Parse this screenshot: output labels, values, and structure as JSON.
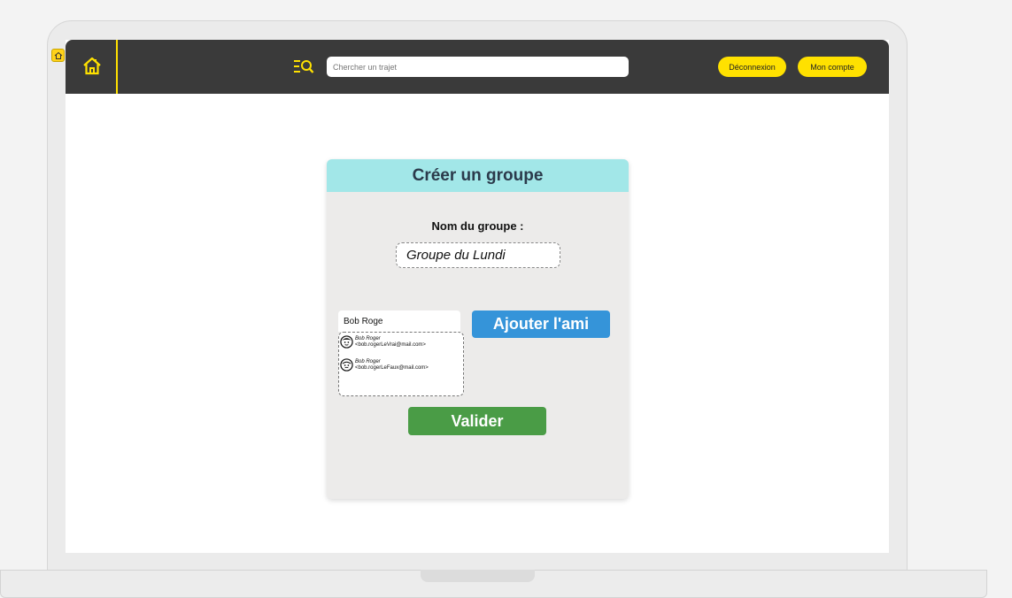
{
  "navbar": {
    "search_placeholder": "Chercher un trajet",
    "logout_label": "Déconnexion",
    "account_label": "Mon compte",
    "accent_color": "#ffe100",
    "bar_color": "#3a3a3a"
  },
  "card": {
    "title": "Créer un groupe",
    "group_name_label": "Nom du groupe :",
    "group_name_value": "Groupe du Lundi",
    "friend_search_value": "Bob Roge",
    "add_friend_label": "Ajouter l'ami",
    "validate_label": "Valider",
    "suggestions": [
      {
        "name": "Bob Roger",
        "email": "<bob.rogerLeVrai@mail.com>"
      },
      {
        "name": "Bob Roger",
        "email": "<bob.rogerLeFaux@mail.com>"
      }
    ],
    "header_color": "#a2e7e8",
    "add_button_color": "#3594d9",
    "validate_button_color": "#4a9c46"
  },
  "icons": {
    "corner": "home-icon",
    "home": "home-icon",
    "search": "search-list-icon",
    "avatar": "user-avatar-icon"
  }
}
